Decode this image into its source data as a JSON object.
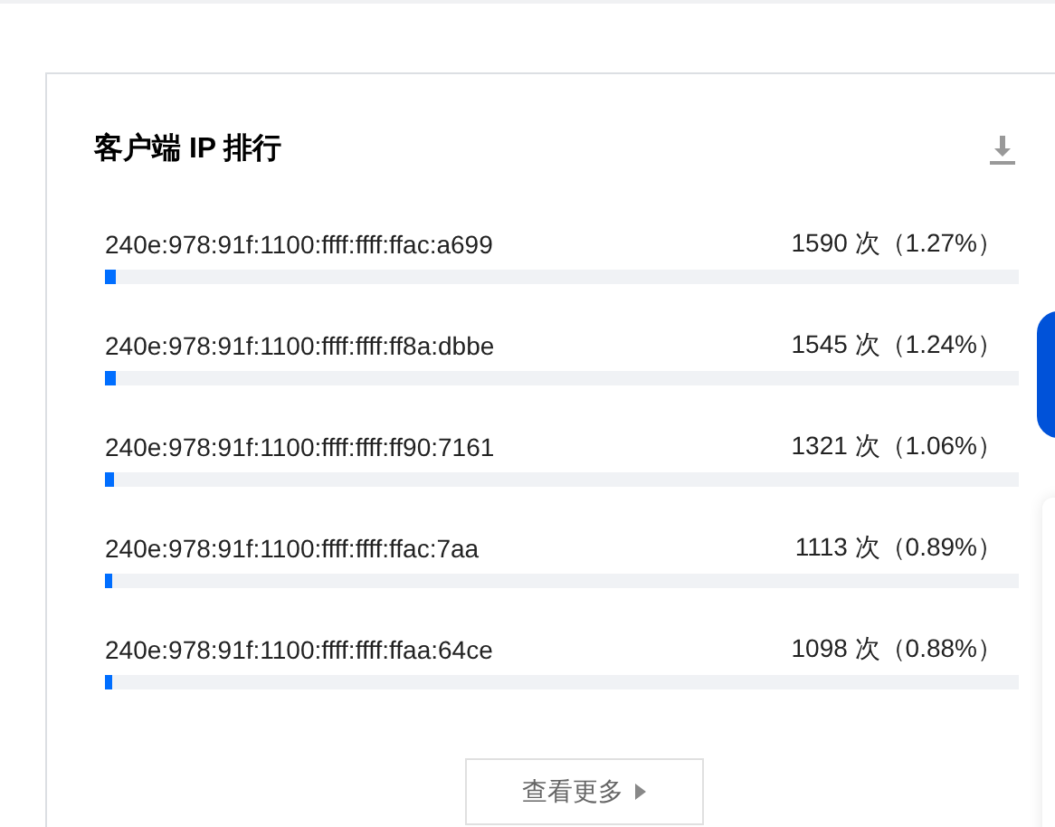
{
  "card": {
    "title": "客户端 IP 排行",
    "rows": [
      {
        "ip": "240e:978:91f:1100:ffff:ffff:ffac:a699",
        "count": "1590 次（1.27%）",
        "level": 0.0127
      },
      {
        "ip": "240e:978:91f:1100:ffff:ffff:ff8a:dbbe",
        "count": "1545 次（1.24%）",
        "level": 0.0124
      },
      {
        "ip": "240e:978:91f:1100:ffff:ffff:ff90:7161",
        "count": "1321 次（1.06%）",
        "level": 0.0106
      },
      {
        "ip": "240e:978:91f:1100:ffff:ffff:ffac:7aa",
        "count": "1113 次（0.89%）",
        "level": 0.0089
      },
      {
        "ip": "240e:978:91f:1100:ffff:ffff:ffaa:64ce",
        "count": "1098 次（0.88%）",
        "level": 0.0088
      }
    ],
    "more_button": "查看更多"
  }
}
